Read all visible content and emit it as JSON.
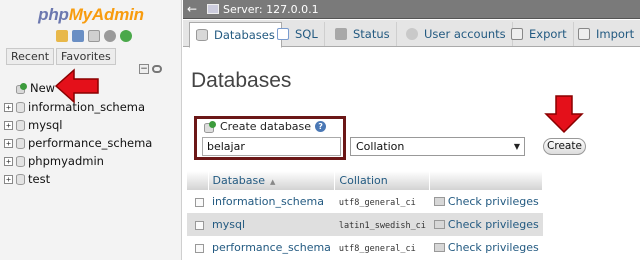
{
  "nav": {
    "logo_part1": "php",
    "logo_part2": "MyAdmin",
    "tabs": [
      "Recent",
      "Favorites"
    ],
    "collapse_symbol": "−",
    "new_label": "New",
    "databases": [
      {
        "name": "information_schema",
        "expander": "+"
      },
      {
        "name": "mysql",
        "expander": "+"
      },
      {
        "name": "performance_schema",
        "expander": "+"
      },
      {
        "name": "phpmyadmin",
        "expander": "+"
      },
      {
        "name": "test",
        "expander": "+"
      }
    ],
    "icons": [
      "home-icon",
      "exit-icon",
      "docs-icon",
      "settings-icon",
      "reload-icon"
    ]
  },
  "topbar": {
    "back_symbol": "←",
    "server_label": "Server: 127.0.0.1"
  },
  "tabs": [
    {
      "label": "Databases",
      "icon": "database-icon",
      "active": true
    },
    {
      "label": "SQL",
      "icon": "sql-icon",
      "active": false
    },
    {
      "label": "Status",
      "icon": "status-icon",
      "active": false
    },
    {
      "label": "User accounts",
      "icon": "users-icon",
      "active": false
    },
    {
      "label": "Export",
      "icon": "export-icon",
      "active": false
    },
    {
      "label": "Import",
      "icon": "import-icon",
      "active": false
    }
  ],
  "main": {
    "title": "Databases",
    "create": {
      "label": "Create database",
      "help_symbol": "?",
      "name_value": "belajar",
      "collation_value": "Collation",
      "caret": "▼",
      "button_label": "Create"
    },
    "table": {
      "headers": {
        "database": "Database",
        "sort_symbol": "▲",
        "collation": "Collation"
      },
      "rows": [
        {
          "database": "information_schema",
          "collation": "utf8_general_ci",
          "action": "Check privileges"
        },
        {
          "database": "mysql",
          "collation": "latin1_swedish_ci",
          "action": "Check privileges"
        },
        {
          "database": "performance_schema",
          "collation": "utf8_general_ci",
          "action": "Check privileges"
        }
      ]
    }
  },
  "colors": {
    "annotation_red": "#e4101a",
    "annotation_box": "#6b1717",
    "link_blue": "#235a81",
    "logo_blue": "#6c78af",
    "logo_orange": "#f89c0e"
  }
}
